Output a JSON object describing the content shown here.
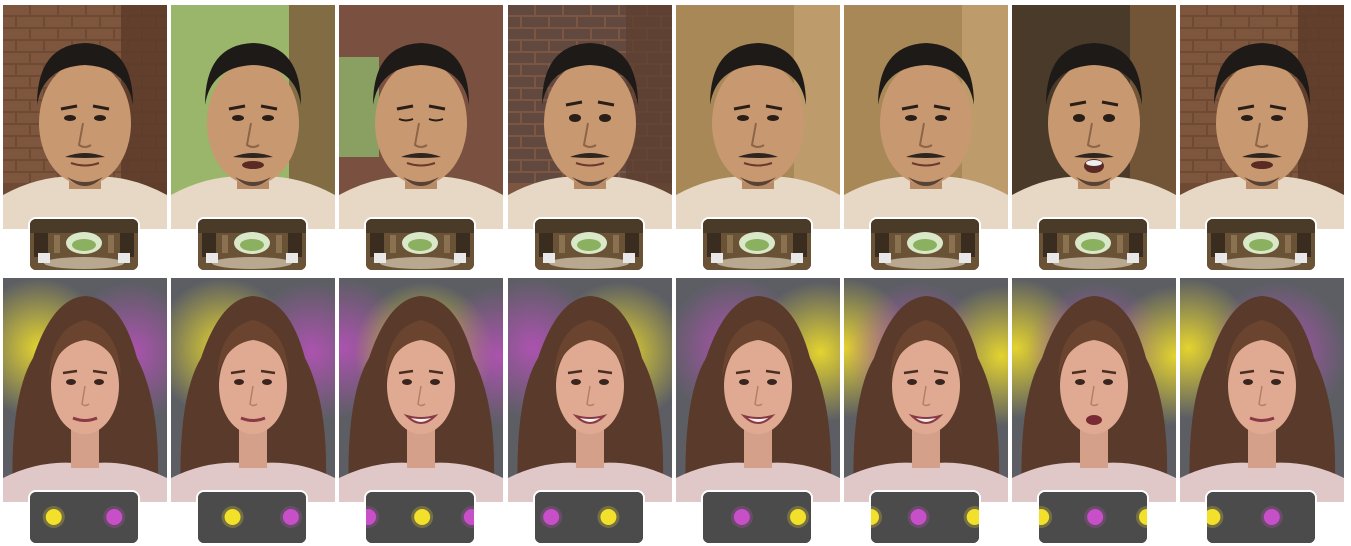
{
  "rows": [
    {
      "id": "man-env-relighting",
      "frames": [
        {
          "bg": "brick",
          "expression": "neutral",
          "env": "indoor-panorama"
        },
        {
          "bg": "garden-door",
          "expression": "speaking",
          "env": "indoor-panorama"
        },
        {
          "bg": "patio-window",
          "expression": "eyes-closed",
          "env": "indoor-panorama"
        },
        {
          "bg": "brick-bbq",
          "expression": "raised-brows",
          "env": "indoor-panorama"
        },
        {
          "bg": "wooden-door",
          "expression": "neutral",
          "env": "indoor-panorama"
        },
        {
          "bg": "wooden-door",
          "expression": "neutral",
          "env": "indoor-panorama"
        },
        {
          "bg": "wooden-door-bright",
          "expression": "surprised",
          "env": "indoor-panorama"
        },
        {
          "bg": "brick",
          "expression": "speaking",
          "env": "indoor-panorama"
        }
      ]
    },
    {
      "id": "woman-point-lights",
      "colors": {
        "yellow": "#f3e02a",
        "magenta": "#c74fc8"
      },
      "frames": [
        {
          "expression": "neutral",
          "lights": [
            {
              "color": "yellow",
              "pos": 0.22
            },
            {
              "color": "magenta",
              "pos": 0.78
            }
          ]
        },
        {
          "expression": "neutral",
          "lights": [
            {
              "color": "yellow",
              "pos": 0.32
            },
            {
              "color": "magenta",
              "pos": 0.86
            }
          ]
        },
        {
          "expression": "smile",
          "lights": [
            {
              "color": "magenta",
              "pos": 0.02
            },
            {
              "color": "yellow",
              "pos": 0.52
            },
            {
              "color": "magenta",
              "pos": 0.98
            }
          ]
        },
        {
          "expression": "smile",
          "lights": [
            {
              "color": "magenta",
              "pos": 0.15
            },
            {
              "color": "yellow",
              "pos": 0.68
            }
          ]
        },
        {
          "expression": "smile",
          "lights": [
            {
              "color": "magenta",
              "pos": 0.36
            },
            {
              "color": "yellow",
              "pos": 0.88
            }
          ]
        },
        {
          "expression": "smile",
          "lights": [
            {
              "color": "yellow",
              "pos": 0.0
            },
            {
              "color": "magenta",
              "pos": 0.44
            },
            {
              "color": "yellow",
              "pos": 0.96
            }
          ]
        },
        {
          "expression": "speaking",
          "lights": [
            {
              "color": "yellow",
              "pos": 0.02
            },
            {
              "color": "magenta",
              "pos": 0.52
            },
            {
              "color": "yellow",
              "pos": 1.0
            }
          ]
        },
        {
          "expression": "neutral",
          "lights": [
            {
              "color": "yellow",
              "pos": 0.05
            },
            {
              "color": "magenta",
              "pos": 0.6
            }
          ]
        }
      ]
    }
  ]
}
